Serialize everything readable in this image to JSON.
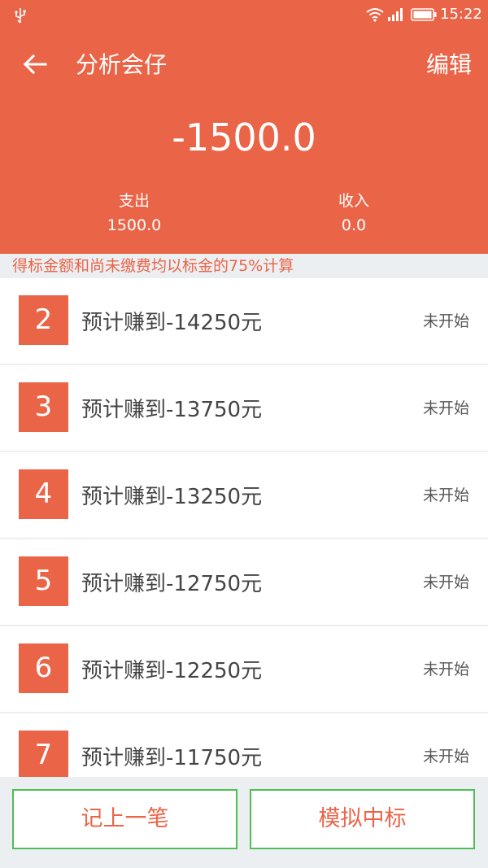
{
  "status_bar": {
    "time": "15:22"
  },
  "header": {
    "title": "分析会仔",
    "edit_label": "编辑",
    "total": "-1500.0",
    "expense_label": "支出",
    "expense_value": "1500.0",
    "income_label": "收入",
    "income_value": "0.0"
  },
  "notice": "得标金额和尚未缴费均以标金的75%计算",
  "rows": [
    {
      "num": "2",
      "text": "预计赚到-14250元",
      "status": "未开始"
    },
    {
      "num": "3",
      "text": "预计赚到-13750元",
      "status": "未开始"
    },
    {
      "num": "4",
      "text": "预计赚到-13250元",
      "status": "未开始"
    },
    {
      "num": "5",
      "text": "预计赚到-12750元",
      "status": "未开始"
    },
    {
      "num": "6",
      "text": "预计赚到-12250元",
      "status": "未开始"
    },
    {
      "num": "7",
      "text": "预计赚到-11750元",
      "status": "未开始"
    }
  ],
  "actions": {
    "record_label": "记上一笔",
    "simulate_label": "模拟中标"
  },
  "colors": {
    "accent": "#ea6548",
    "button_border": "#4fbf53",
    "background": "#eceff2"
  }
}
